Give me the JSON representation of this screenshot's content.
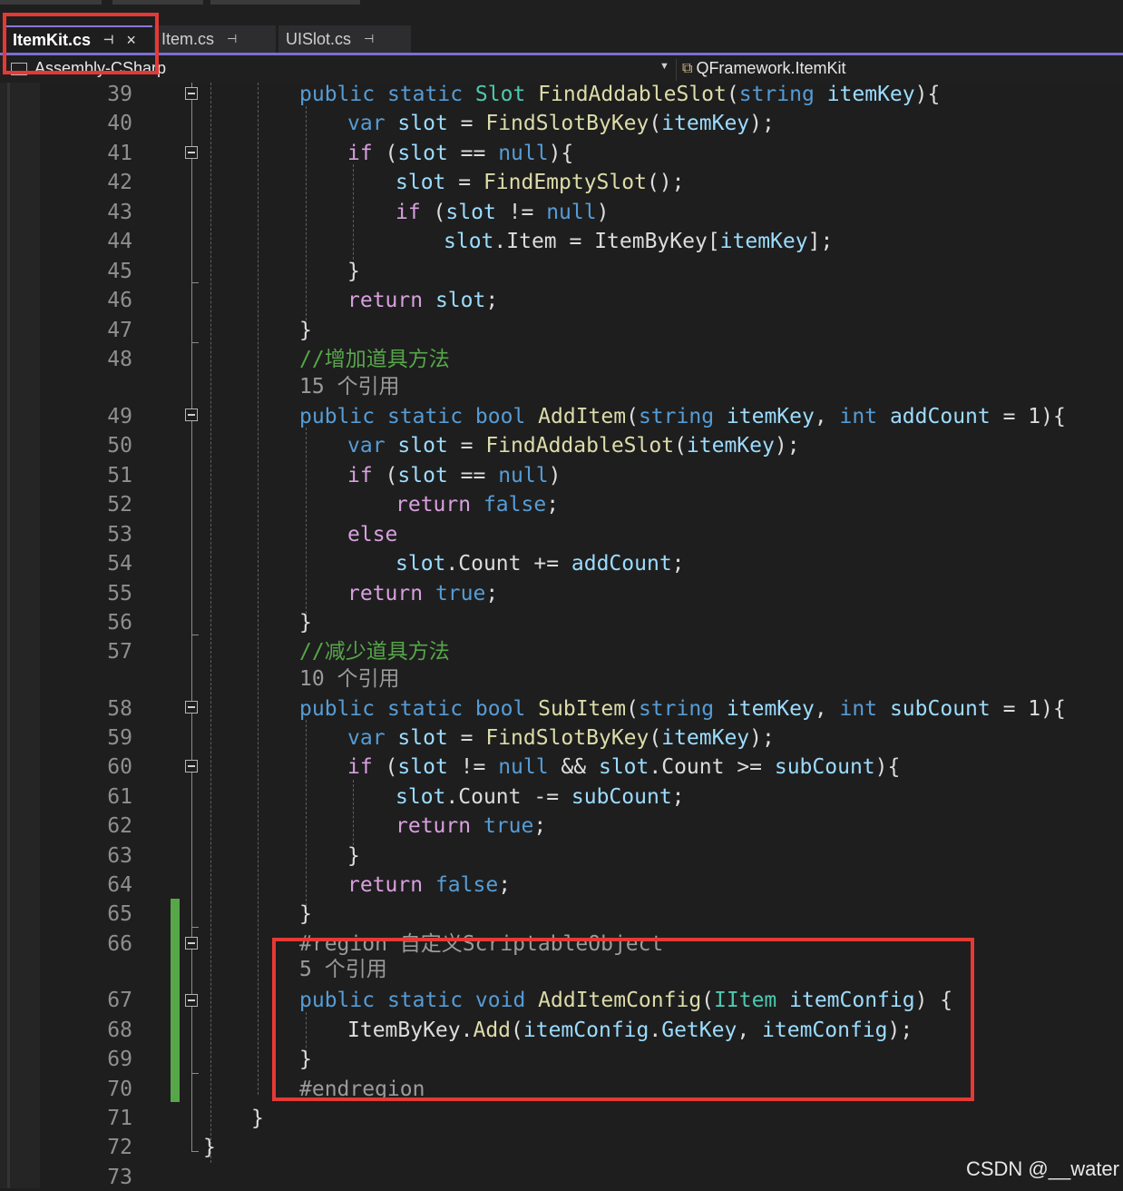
{
  "tabs": [
    {
      "label": "ItemKit.cs",
      "pin": "pin-icon",
      "close": "×",
      "active": true
    },
    {
      "label": "Item.cs",
      "pin": "pin-icon",
      "active": false
    },
    {
      "label": "UISlot.cs",
      "pin": "pin-icon",
      "active": false
    }
  ],
  "nav": {
    "project": "Assembly-CSharp",
    "member": "QFramework.ItemKit",
    "project_icon": "project-icon",
    "member_icon": "class-icon",
    "dropdown_icon": "chevron-down-icon"
  },
  "line_numbers": [
    "39",
    "40",
    "41",
    "42",
    "43",
    "44",
    "45",
    "46",
    "47",
    "48",
    "49",
    "50",
    "51",
    "52",
    "53",
    "54",
    "55",
    "56",
    "57",
    "58",
    "59",
    "60",
    "61",
    "62",
    "63",
    "64",
    "65",
    "66",
    "67",
    "68",
    "69",
    "70",
    "71",
    "72",
    "73"
  ],
  "codelens": {
    "add_item_refs": "15 个引用",
    "sub_item_refs": "10 个引用",
    "add_item_config_refs": "5 个引用"
  },
  "code": {
    "l39": {
      "pub": "public",
      "st": "static",
      "ty": "Slot",
      "fn": "FindAddableSlot",
      "p1": "(",
      "kw": "string",
      "var": "itemKey",
      "p2": "){"
    },
    "l40": {
      "kw": "var",
      "var": "slot",
      "op": " = ",
      "fn": "FindSlotByKey",
      "p1": "(",
      "a": "itemKey",
      "p2": ");"
    },
    "l41": {
      "ctl": "if",
      "p1": " (",
      "var": "slot",
      "op": " == ",
      "kw": "null",
      "p2": "){"
    },
    "l42": {
      "var": "slot",
      "op": " = ",
      "fn": "FindEmptySlot",
      "p": "();"
    },
    "l43": {
      "ctl": "if",
      "p1": " (",
      "var": "slot",
      "op": " != ",
      "kw": "null",
      "p2": ")"
    },
    "l44": {
      "var": "slot",
      "dot": ".",
      "prop": "Item",
      "op": " = ",
      "ty": "ItemByKey",
      "b1": "[",
      "a": "itemKey",
      "b2": "];"
    },
    "l45": {
      "p": "}"
    },
    "l46": {
      "ctl": "return",
      "var": " slot",
      "p": ";"
    },
    "l47": {
      "p": "}"
    },
    "l48": {
      "cm": "//增加道具方法"
    },
    "l49": {
      "pub": "public",
      "st": "static",
      "kw": "bool",
      "fn": "AddItem",
      "p1": "(",
      "kw2": "string",
      "v1": "itemKey",
      "c": ", ",
      "kw3": "int",
      "v2": "addCount",
      "eq": " = 1){"
    },
    "l50": {
      "kw": "var",
      "var": "slot",
      "op": " = ",
      "fn": "FindAddableSlot",
      "p1": "(",
      "a": "itemKey",
      "p2": ");"
    },
    "l51": {
      "ctl": "if",
      "p1": " (",
      "var": "slot",
      "op": " == ",
      "kw": "null",
      "p2": ")"
    },
    "l52": {
      "ctl": "return",
      "kw": " false",
      "p": ";"
    },
    "l53": {
      "ctl": "else"
    },
    "l54": {
      "var": "slot",
      "dot": ".",
      "prop": "Count",
      "op": " += ",
      "a": "addCount",
      "p": ";"
    },
    "l55": {
      "ctl": "return",
      "kw": " true",
      "p": ";"
    },
    "l56": {
      "p": "}"
    },
    "l57": {
      "cm": "//减少道具方法"
    },
    "l58": {
      "pub": "public",
      "st": "static",
      "kw": "bool",
      "fn": "SubItem",
      "p1": "(",
      "kw2": "string",
      "v1": "itemKey",
      "c": ", ",
      "kw3": "int",
      "v2": "subCount",
      "eq": " = 1){"
    },
    "l59": {
      "kw": "var",
      "var": "slot",
      "op": " = ",
      "fn": "FindSlotByKey",
      "p1": "(",
      "a": "itemKey",
      "p2": ");"
    },
    "l60": {
      "ctl": "if",
      "p1": " (",
      "var": "slot",
      "op": " != ",
      "kw": "null",
      "and": " && ",
      "v2": "slot",
      "dot": ".",
      "prop": "Count",
      "op2": " >= ",
      "a": "subCount",
      "p2": "){"
    },
    "l61": {
      "var": "slot",
      "dot": ".",
      "prop": "Count",
      "op": " -= ",
      "a": "subCount",
      "p": ";"
    },
    "l62": {
      "ctl": "return",
      "kw": " true",
      "p": ";"
    },
    "l63": {
      "p": "}"
    },
    "l64": {
      "ctl": "return",
      "kw": " false",
      "p": ";"
    },
    "l65": {
      "p": "}"
    },
    "l66": {
      "pp": "#region 自定义ScriptableObject"
    },
    "l67": {
      "pub": "public",
      "st": "static",
      "kw": "void",
      "fn": "AddItemConfig",
      "p1": "(",
      "ty": "IItem",
      "v": " itemConfig",
      "p2": ") {"
    },
    "l68": {
      "ty": "ItemByKey",
      "dot": ".",
      "fn": "Add",
      "p1": "(",
      "v1": "itemConfig",
      "dot2": ".",
      "fn2": "GetKey",
      "c": ", ",
      "v2": "itemConfig",
      "p2": ");"
    },
    "l69": {
      "p": "}"
    },
    "l70": {
      "pp": "#endregion"
    },
    "l71": {
      "p": "}"
    },
    "l72": {
      "p": "}"
    }
  },
  "watermark": "CSDN @__water",
  "colors": {
    "keyword": "#569cd6",
    "control": "#d8a0df",
    "type": "#4ec9b0",
    "method": "#dcdcaa",
    "variable": "#9cdcfe",
    "comment": "#57a64a",
    "highlight_box": "#e53935",
    "change_bar": "#57a64a"
  }
}
